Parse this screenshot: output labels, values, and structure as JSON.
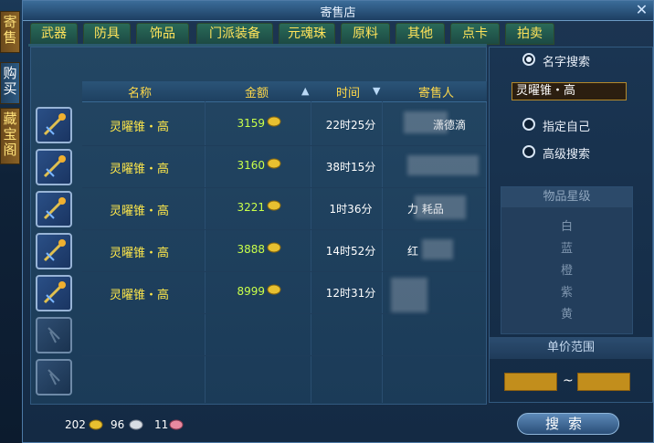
{
  "window": {
    "title": "寄售店",
    "close_icon": "close-icon"
  },
  "side_tabs": [
    {
      "label": "寄售",
      "state": "inactive"
    },
    {
      "label": "购买",
      "state": "active"
    },
    {
      "label": "藏宝阁",
      "state": "inactive"
    }
  ],
  "category_tabs": [
    "武器",
    "防具",
    "饰品",
    "门派装备",
    "元魂珠",
    "原料",
    "其他",
    "点卡",
    "拍卖"
  ],
  "table": {
    "headers": {
      "name": "名称",
      "price": "金额",
      "time": "时间",
      "seller": "寄售人"
    },
    "rows": [
      {
        "name": "灵曜锥・高",
        "price": "3159",
        "time": "22时25分",
        "seller": "潇德滴"
      },
      {
        "name": "灵曜锥・高",
        "price": "3160",
        "time": "38时15分",
        "seller": ""
      },
      {
        "name": "灵曜锥・高",
        "price": "3221",
        "time": "1时36分",
        "seller": "力  耗品"
      },
      {
        "name": "灵曜锥・高",
        "price": "3888",
        "time": "14时52分",
        "seller": "红"
      },
      {
        "name": "灵曜锥・高",
        "price": "8999",
        "time": "12时31分",
        "seller": ""
      }
    ]
  },
  "currency": {
    "gold": "202",
    "silver": "96",
    "copper": "11"
  },
  "search": {
    "mode_name": "名字搜索",
    "name_value": "灵曜锥・高",
    "mode_self": "指定自己",
    "mode_advanced": "高级搜索",
    "rarity_title": "物品星级",
    "rarities": [
      "白",
      "蓝",
      "橙",
      "紫",
      "黄"
    ],
    "price_range_title": "单价范围",
    "range_separator": "~",
    "button_label": "搜索"
  },
  "colors": {
    "name_text": "#ffe84a",
    "price_text": "#c9ff4a",
    "header_text": "#ffd94a",
    "tab_text": "#ffe35a"
  }
}
